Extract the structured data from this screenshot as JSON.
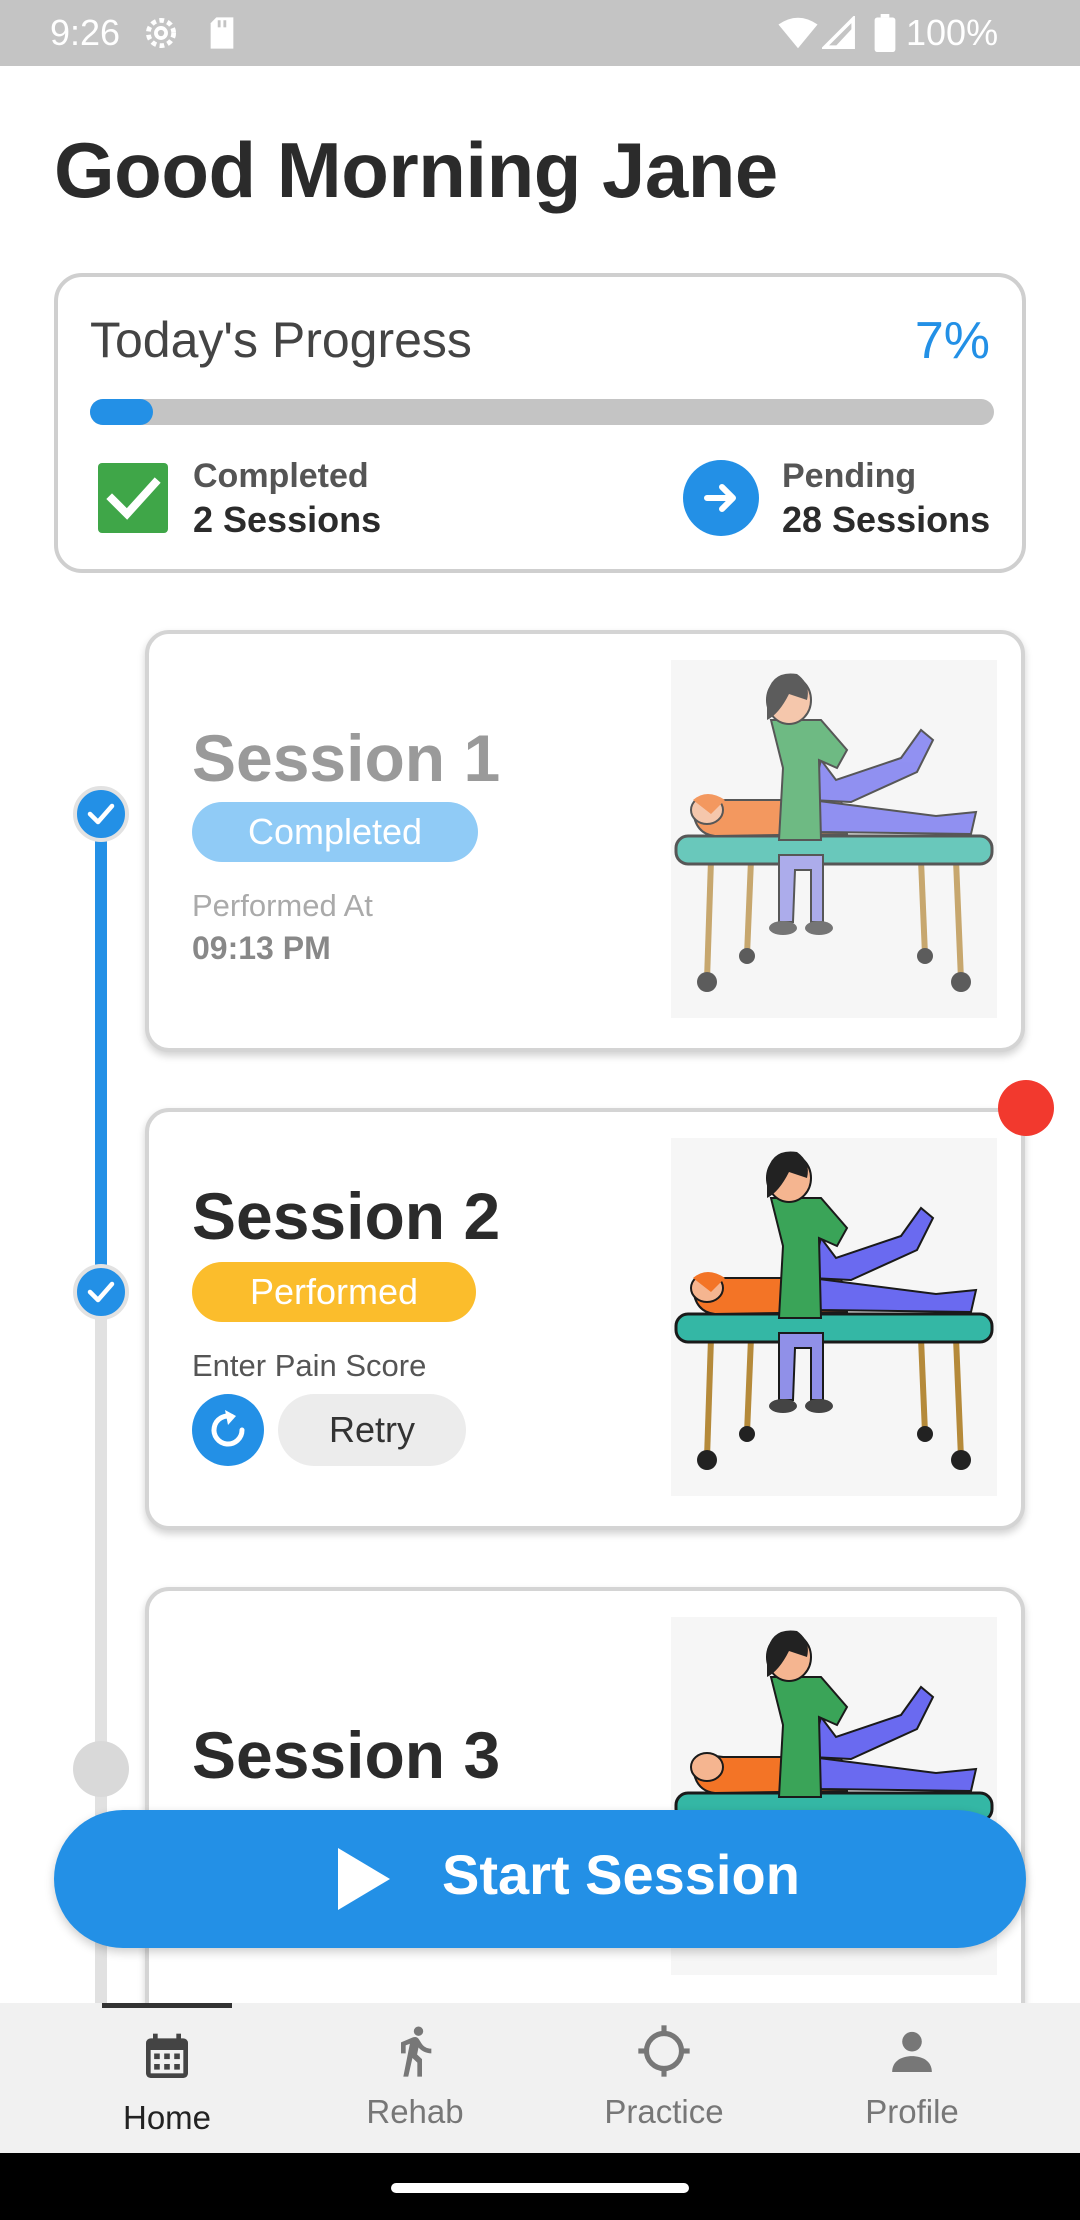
{
  "status_bar": {
    "time": "9:26",
    "battery": "100%"
  },
  "greeting": "Good Morning Jane",
  "progress": {
    "title": "Today's Progress",
    "percent_label": "7%",
    "percent_value": 7,
    "completed_label": "Completed",
    "completed_value": "2 Sessions",
    "pending_label": "Pending",
    "pending_value": "28 Sessions"
  },
  "sessions": [
    {
      "title": "Session 1",
      "status": "Completed",
      "performed_at_label": "Performed At",
      "performed_time": "09:13 PM",
      "image_icon": "physiotherapy-illustration"
    },
    {
      "title": "Session 2",
      "status": "Performed",
      "pain_label": "Enter Pain Score",
      "retry_label": "Retry",
      "image_icon": "physiotherapy-illustration"
    },
    {
      "title": "Session 3",
      "image_icon": "physiotherapy-illustration"
    }
  ],
  "start_button": {
    "label": "Start Session"
  },
  "nav": [
    {
      "label": "Home",
      "icon": "calendar-icon"
    },
    {
      "label": "Rehab",
      "icon": "walking-icon"
    },
    {
      "label": "Practice",
      "icon": "crosshair-icon"
    },
    {
      "label": "Profile",
      "icon": "person-icon"
    }
  ],
  "colors": {
    "accent": "#2390e6",
    "completed_pill": "#90cbf6",
    "performed_pill": "#fbbd2c",
    "check_green": "#3fa648",
    "notification": "#f2392e",
    "status_bar": "#c4c4c4"
  }
}
